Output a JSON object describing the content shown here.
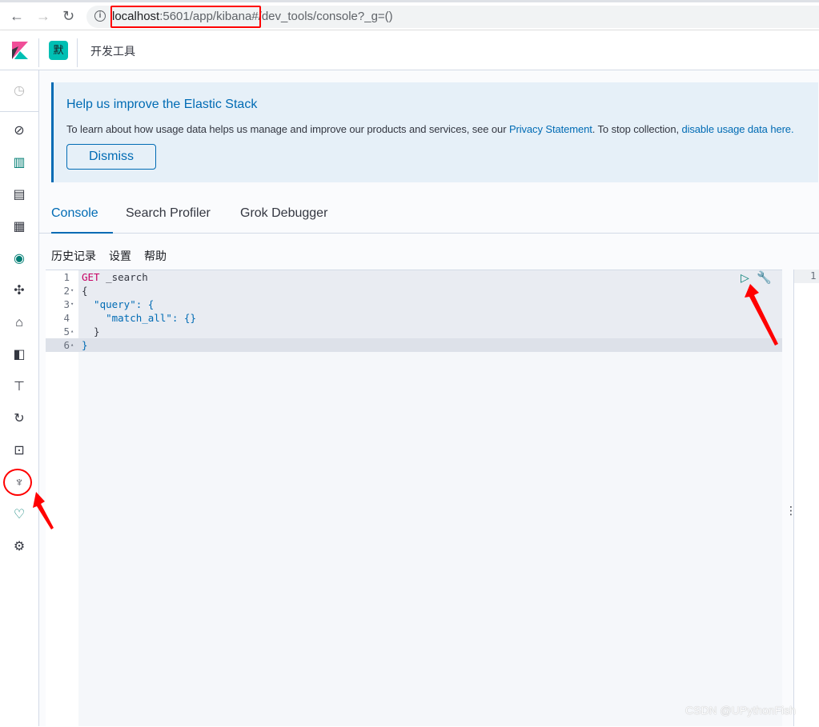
{
  "browser": {
    "url_host": "localhost",
    "url_rest": ":5601/app/kibana#/dev_tools/console?_g=()",
    "back": "←",
    "forward": "→",
    "reload": "↻"
  },
  "header": {
    "space_initial": "默",
    "breadcrumb": "开发工具"
  },
  "sidebar": {
    "items": [
      "recently-viewed",
      "discover",
      "visualize",
      "dashboard",
      "canvas",
      "maps",
      "machine-learning",
      "infrastructure",
      "logs",
      "apm",
      "uptime",
      "siem",
      "dev-tools",
      "monitoring",
      "management"
    ],
    "active": "dev-tools"
  },
  "banner": {
    "title": "Help us improve the Elastic Stack",
    "text": "To learn about how usage data helps us manage and improve our products and services, see our ",
    "link1": "Privacy Statement",
    "text2": ". To stop collection, ",
    "link2": "disable usage data here.",
    "dismiss": "Dismiss"
  },
  "tabs": [
    {
      "label": "Console",
      "active": true
    },
    {
      "label": "Search Profiler"
    },
    {
      "label": "Grok Debugger"
    }
  ],
  "toolbar": {
    "history": "历史记录",
    "settings": "设置",
    "help": "帮助"
  },
  "editor": {
    "lines": [
      {
        "n": "1",
        "fold": "",
        "method": "GET",
        "text": " _search"
      },
      {
        "n": "2",
        "fold": "▾",
        "text": "{"
      },
      {
        "n": "3",
        "fold": "▾",
        "text": "  \"query\": {"
      },
      {
        "n": "4",
        "fold": "",
        "text": "    \"match_all\": {}"
      },
      {
        "n": "5",
        "fold": "▴",
        "text": "  }"
      },
      {
        "n": "6",
        "fold": "▴",
        "text": "}"
      }
    ]
  },
  "output": {
    "line": "1"
  },
  "watermark": "CSDN @UPythonFish",
  "colors": {
    "accent": "#006bb4",
    "annotation": "#ff0000",
    "space": "#00bfb3"
  }
}
